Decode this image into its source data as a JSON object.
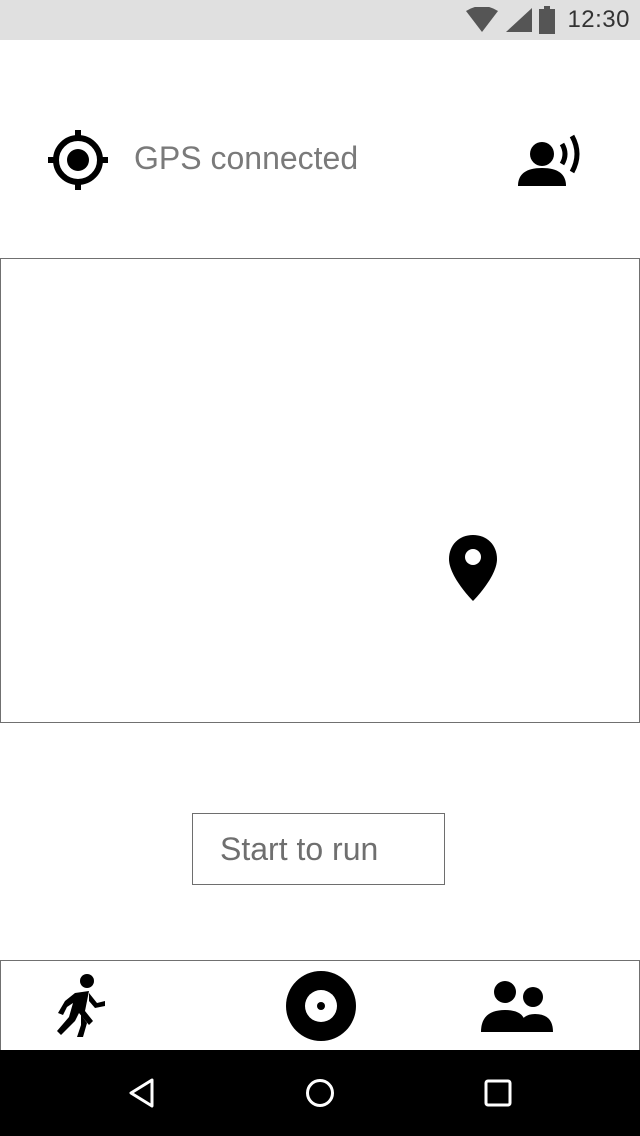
{
  "status_bar": {
    "time": "12:30",
    "icons": [
      "wifi-icon",
      "cell-signal-icon",
      "battery-icon"
    ]
  },
  "gps_status": {
    "icon": "gps-fixed-icon",
    "text": "GPS connected",
    "voice_icon": "voice-over-icon"
  },
  "map": {
    "marker_icon": "location-pin-icon"
  },
  "actions": {
    "start_label": "Start to run"
  },
  "bottom_nav": {
    "items": [
      {
        "icon": "runner-icon",
        "label": ""
      },
      {
        "icon": "record-icon",
        "label": ""
      },
      {
        "icon": "people-icon",
        "label": ""
      }
    ]
  },
  "system_nav": {
    "items": [
      "back-icon",
      "home-icon",
      "recents-icon"
    ]
  },
  "colors": {
    "status_bar_bg": "#e0e0e0",
    "text_gray": "#7a7a7a",
    "border": "#707070",
    "system_nav_bg": "#000000"
  }
}
